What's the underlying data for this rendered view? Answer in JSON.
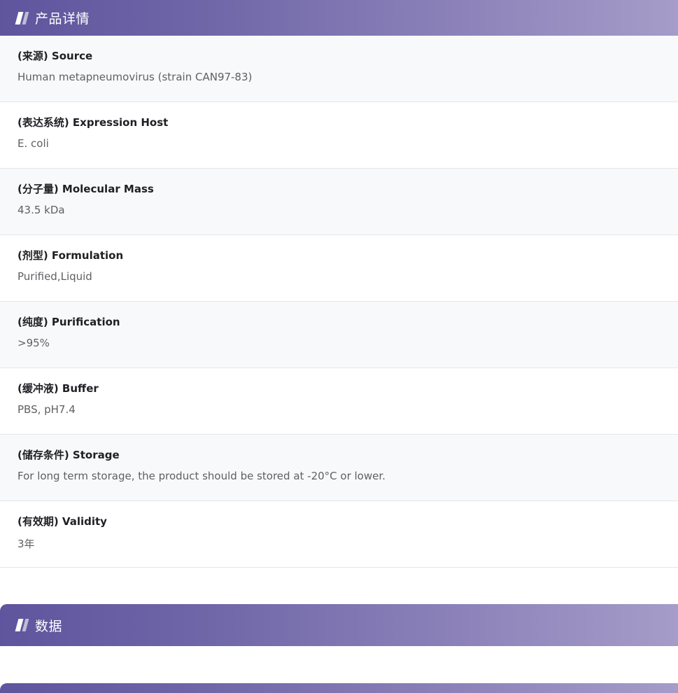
{
  "sections": {
    "details_title": "产品详情",
    "data_title": "数据"
  },
  "details": [
    {
      "label": "(来源) Source",
      "value": "Human metapneumovirus (strain CAN97-83)"
    },
    {
      "label": "(表达系统) Expression Host",
      "value": "E. coli"
    },
    {
      "label": "(分子量) Molecular Mass",
      "value": "43.5 kDa"
    },
    {
      "label": "(剂型) Formulation",
      "value": "Purified,Liquid"
    },
    {
      "label": "(纯度) Purification",
      "value": ">95%"
    },
    {
      "label": "(缓冲液) Buffer",
      "value": "PBS, pH7.4"
    },
    {
      "label": "(储存条件) Storage",
      "value": "For long term storage, the product should be stored at -20°C or lower."
    },
    {
      "label": "(有效期) Validity",
      "value": "3年"
    }
  ],
  "colors": {
    "header_gradient_start": "#5e559e",
    "header_gradient_end": "#a59cc9",
    "row_shade": "#f8f9fa"
  },
  "icons": {
    "header_icon": "slash-bars-icon"
  }
}
